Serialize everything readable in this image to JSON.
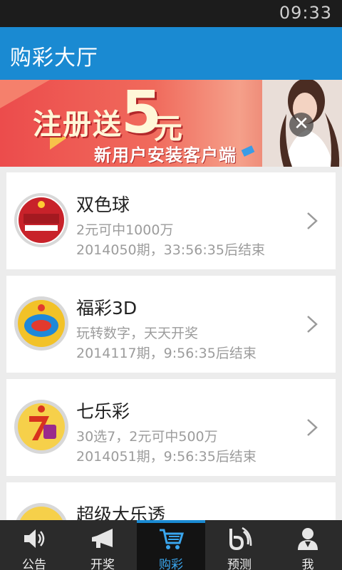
{
  "status_bar": {
    "time": "09:33"
  },
  "header": {
    "title": "购彩大厅"
  },
  "banner": {
    "headline": "注册送",
    "big_number": "5",
    "unit": "元",
    "subtitle": "新用户安装客户端",
    "close_symbol": "✕"
  },
  "lotteries": [
    {
      "name": "双色球",
      "desc": "2元可中1000万",
      "issue": "2014050期，33:56:35后结束",
      "logo_icon": "union-lotto-logo-icon",
      "logo_color": "#c8222a"
    },
    {
      "name": "福彩3D",
      "desc": "玩转数字，天天开奖",
      "issue": "2014117期，9:56:35后结束",
      "logo_icon": "fucai-3d-logo-icon",
      "logo_color": "#1e88d8"
    },
    {
      "name": "七乐彩",
      "desc": "30选7，2元可中500万",
      "issue": "2014051期，9:56:35后结束",
      "logo_icon": "qilecai-logo-icon",
      "logo_color": "#e8a21c"
    },
    {
      "name": "超级大乐透",
      "desc": "",
      "issue": "",
      "logo_icon": "daletou-logo-icon",
      "logo_color": "#1f7fd0"
    }
  ],
  "tabs": [
    {
      "label": "公告",
      "icon": "speaker-icon",
      "active": false
    },
    {
      "label": "开奖",
      "icon": "megaphone-icon",
      "active": false
    },
    {
      "label": "购彩",
      "icon": "shopping-cart-icon",
      "active": true
    },
    {
      "label": "预测",
      "icon": "forecast-icon",
      "active": false
    },
    {
      "label": "我",
      "icon": "user-icon",
      "active": false
    }
  ],
  "colors": {
    "header": "#1a8ad2",
    "tab_bar": "#2b2b2b",
    "active_tab": "#131313"
  }
}
